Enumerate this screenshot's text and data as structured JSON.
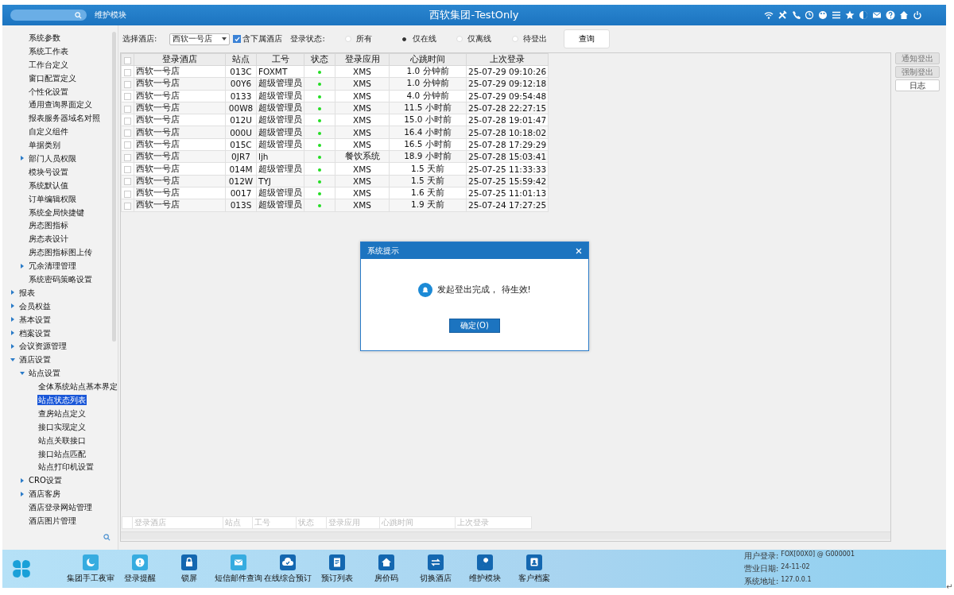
{
  "header": {
    "module": "维护模块",
    "title": "西软集团-TestOnly"
  },
  "sidebar": {
    "continued_items": [
      {
        "label": "系统参数",
        "selected": false
      },
      {
        "label": "系统工作表",
        "selected": false
      },
      {
        "label": "工作台定义",
        "selected": false
      },
      {
        "label": "窗口配置定义",
        "selected": false
      },
      {
        "label": "个性化设置",
        "selected": false
      },
      {
        "label": "通用查询界面定义",
        "selected": false
      },
      {
        "label": "报表服务器域名对照",
        "selected": false
      },
      {
        "label": "自定义组件",
        "selected": false
      },
      {
        "label": "单据类别",
        "selected": false
      },
      {
        "label": "部门人员权限",
        "selected": false,
        "expanded": false
      },
      {
        "label": "模块号设置",
        "selected": false
      },
      {
        "label": "系统默认值",
        "selected": false
      },
      {
        "label": "订单编辑权限",
        "selected": false
      },
      {
        "label": "系统全局快捷键",
        "selected": false
      },
      {
        "label": "房态图指标",
        "selected": false
      },
      {
        "label": "房态表设计",
        "selected": false
      },
      {
        "label": "房态图指标图上传",
        "selected": false
      },
      {
        "label": "冗余清理管理",
        "selected": false,
        "expanded": false
      },
      {
        "label": "系统密码策略设置",
        "selected": false
      }
    ],
    "items": [
      {
        "label": "报表",
        "selected": false,
        "expanded": false
      },
      {
        "label": "会员权益",
        "selected": false,
        "expanded": false
      },
      {
        "label": "基本设置",
        "selected": false,
        "expanded": false
      },
      {
        "label": "档案设置",
        "selected": false,
        "expanded": false
      },
      {
        "label": "会议资源管理",
        "selected": false,
        "expanded": false
      },
      {
        "label": "酒店设置",
        "selected": false,
        "expanded": true,
        "children": [
          {
            "label": "站点设置",
            "selected": false,
            "expanded": true,
            "children": [
              {
                "label": "全体系统站点基本界定",
                "selected": false
              },
              {
                "label": "站点状态列表",
                "selected": true
              },
              {
                "label": "查房站点定义",
                "selected": false
              },
              {
                "label": "接口实现定义",
                "selected": false
              },
              {
                "label": "站点关联接口",
                "selected": false
              },
              {
                "label": "接口站点匹配",
                "selected": false
              },
              {
                "label": "站点打印机设置",
                "selected": false
              }
            ]
          },
          {
            "label": "CRO设置",
            "selected": false,
            "expanded": false
          },
          {
            "label": "酒店客房",
            "selected": false,
            "expanded": false
          },
          {
            "label": "酒店登录网站管理",
            "selected": false
          },
          {
            "label": "酒店图片管理",
            "selected": false
          }
        ]
      }
    ]
  },
  "filters": {
    "hotel_label": "选择酒店:",
    "hotel_value": "西软一号店",
    "include_sub": {
      "label": "含下属酒店",
      "checked": true
    },
    "status_label": "登录状态:",
    "status_options": [
      {
        "label": "所有",
        "selected": false
      },
      {
        "label": "仅在线",
        "selected": true
      },
      {
        "label": "仅离线",
        "selected": false
      },
      {
        "label": "待登出",
        "selected": false
      }
    ],
    "query_button": "查询"
  },
  "table": {
    "header_checked": false,
    "columns": [
      "登录酒店",
      "站点",
      "工号",
      "状态",
      "登录应用",
      "心跳时间",
      "上次登录"
    ],
    "rows": [
      {
        "checked": false,
        "hotel": "西软一号店",
        "station": "013C",
        "user": "FOXMT",
        "online": true,
        "app": "XMS",
        "heartbeat": "1.0 分钟前",
        "last_login": "25-07-29 09:10:26"
      },
      {
        "checked": false,
        "hotel": "西软一号店",
        "station": "00Y6",
        "user": "超级管理员",
        "online": true,
        "app": "XMS",
        "heartbeat": "1.0 分钟前",
        "last_login": "25-07-29 09:12:18"
      },
      {
        "checked": false,
        "hotel": "西软一号店",
        "station": "0133",
        "user": "超级管理员",
        "online": true,
        "app": "XMS",
        "heartbeat": "4.0 分钟前",
        "last_login": "25-07-29 09:54:48"
      },
      {
        "checked": false,
        "hotel": "西软一号店",
        "station": "00W8",
        "user": "超级管理员",
        "online": true,
        "app": "XMS",
        "heartbeat": "11.5 小时前",
        "last_login": "25-07-28 22:27:15"
      },
      {
        "checked": false,
        "hotel": "西软一号店",
        "station": "012U",
        "user": "超级管理员",
        "online": true,
        "app": "XMS",
        "heartbeat": "15.0 小时前",
        "last_login": "25-07-28 19:01:47"
      },
      {
        "checked": false,
        "hotel": "西软一号店",
        "station": "000U",
        "user": "超级管理员",
        "online": true,
        "app": "XMS",
        "heartbeat": "16.4 小时前",
        "last_login": "25-07-28 10:18:02"
      },
      {
        "checked": false,
        "hotel": "西软一号店",
        "station": "015C",
        "user": "超级管理员",
        "online": true,
        "app": "XMS",
        "heartbeat": "16.5 小时前",
        "last_login": "25-07-28 17:29:29"
      },
      {
        "checked": false,
        "hotel": "西软一号店",
        "station": "0JR7",
        "user": "ljh",
        "online": true,
        "app": "餐饮系统",
        "heartbeat": "18.9 小时前",
        "last_login": "25-07-28 15:03:41"
      },
      {
        "checked": false,
        "hotel": "西软一号店",
        "station": "014M",
        "user": "超级管理员",
        "online": true,
        "app": "XMS",
        "heartbeat": "1.5 天前",
        "last_login": "25-07-25 11:33:33"
      },
      {
        "checked": false,
        "hotel": "西软一号店",
        "station": "012W",
        "user": "TYJ",
        "online": true,
        "app": "XMS",
        "heartbeat": "1.5 天前",
        "last_login": "25-07-25 15:59:42"
      },
      {
        "checked": false,
        "hotel": "西软一号店",
        "station": "0017",
        "user": "超级管理员",
        "online": true,
        "app": "XMS",
        "heartbeat": "1.6 天前",
        "last_login": "25-07-25 11:01:13"
      },
      {
        "checked": false,
        "hotel": "西软一号店",
        "station": "013S",
        "user": "超级管理员",
        "online": true,
        "app": "XMS",
        "heartbeat": "1.9 天前",
        "last_login": "25-07-24 17:27:25"
      }
    ],
    "footer_columns": [
      "登录酒店",
      "站点",
      "工号",
      "状态",
      "登录应用",
      "心跳时间",
      "上次登录"
    ]
  },
  "side_buttons": [
    {
      "label": "通知登出",
      "disabled": true
    },
    {
      "label": "强制登出",
      "disabled": true
    },
    {
      "label": "日志",
      "disabled": false
    }
  ],
  "dialog": {
    "title": "系统提示",
    "message": "发起登出完成， 待生效!",
    "button": "确定(O)"
  },
  "dock": [
    "集团手工夜审",
    "登录提醒",
    "锁屏",
    "短信邮件查询",
    "在线综合预订",
    "预订列表",
    "房价码",
    "切换酒店",
    "维护模块",
    "客户档案"
  ],
  "status": [
    {
      "label": "用户登录:",
      "value": "FOX[00X0] @ G000001"
    },
    {
      "label": "营业日期:",
      "value": "24-11-02"
    },
    {
      "label": "系统地址:",
      "value": "127.0.0.1"
    }
  ],
  "corner_mark": "↵"
}
